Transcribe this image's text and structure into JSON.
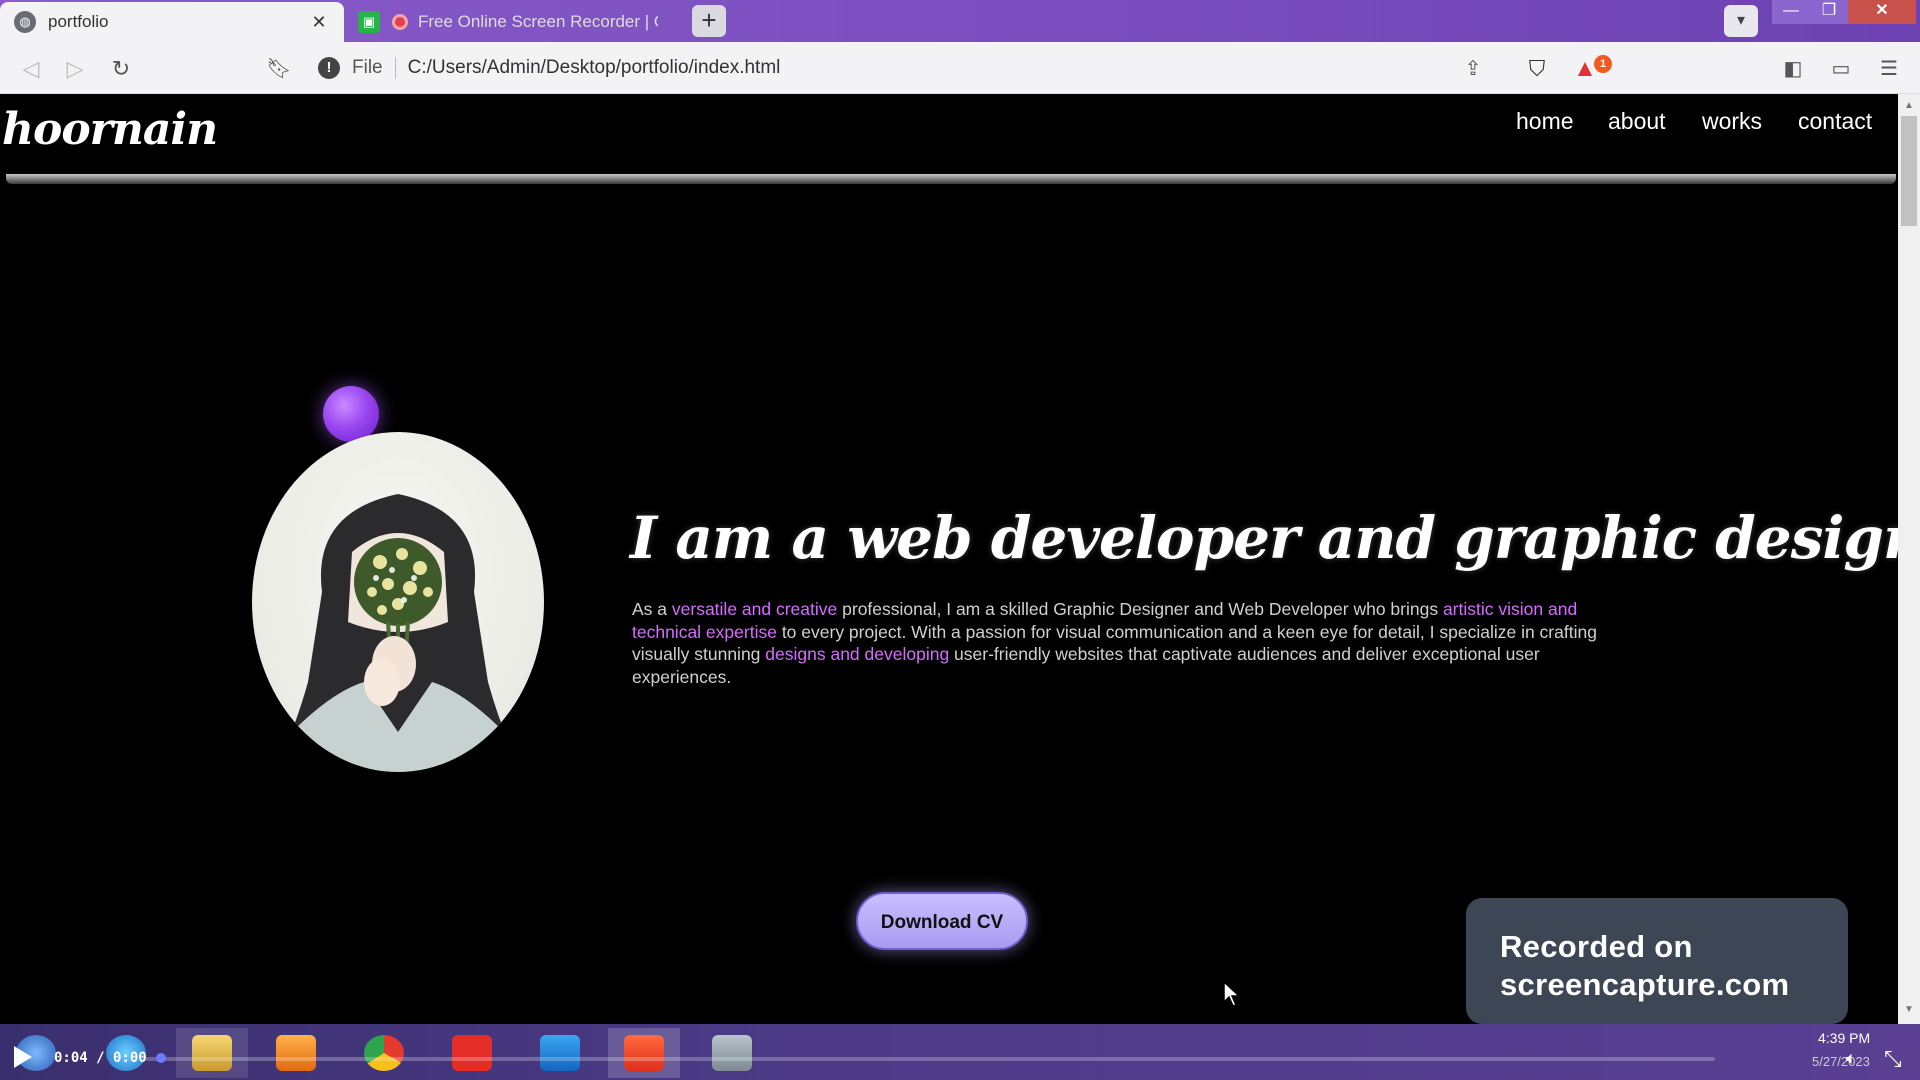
{
  "browser": {
    "tabs": [
      {
        "label": "portfolio",
        "active": true
      },
      {
        "label": "Free Online Screen Recorder | Onl",
        "active": false
      }
    ],
    "new_tab_label": "+",
    "address": {
      "scheme": "File",
      "url": "C:/Users/Admin/Desktop/portfolio/index.html"
    },
    "alert_count": "1"
  },
  "site": {
    "logo": "hoornain",
    "nav": [
      {
        "label": "home"
      },
      {
        "label": "about"
      },
      {
        "label": "works"
      },
      {
        "label": "contact"
      }
    ],
    "headline": "I am a web developer and graphic designer",
    "intro": {
      "p1": "As a ",
      "h1": "versatile and creative",
      "p2": " professional, I am a skilled Graphic Designer and Web Developer who brings ",
      "h2": "artistic vision and technical expertise",
      "p3": " to every project. With a passion for visual communication and a keen eye for detail, I specialize in crafting visually stunning ",
      "h3": "designs and developing",
      "p4": " user-friendly websites that captivate audiences and deliver exceptional user experiences."
    },
    "download_button": "Download CV",
    "accent_color": "#d66bff"
  },
  "watermark": {
    "line1": "Recorded on",
    "line2": "screencapture.com"
  },
  "player": {
    "time": "0:04 / 0:00",
    "progress": 0.01
  },
  "system_tray": {
    "clock": "4:39 PM",
    "date": "5/27/2023"
  },
  "icons": [
    "globe-icon",
    "close-icon",
    "record-icon",
    "chevron-down-icon",
    "back-icon",
    "forward-icon",
    "reload-icon",
    "bookmark-icon",
    "info-icon",
    "share-icon",
    "brave-shield-icon",
    "brave-rewards-icon",
    "sidebar-icon",
    "wallet-icon",
    "menu-icon",
    "play-icon",
    "volume-icon",
    "expand-icon",
    "cursor-icon"
  ]
}
